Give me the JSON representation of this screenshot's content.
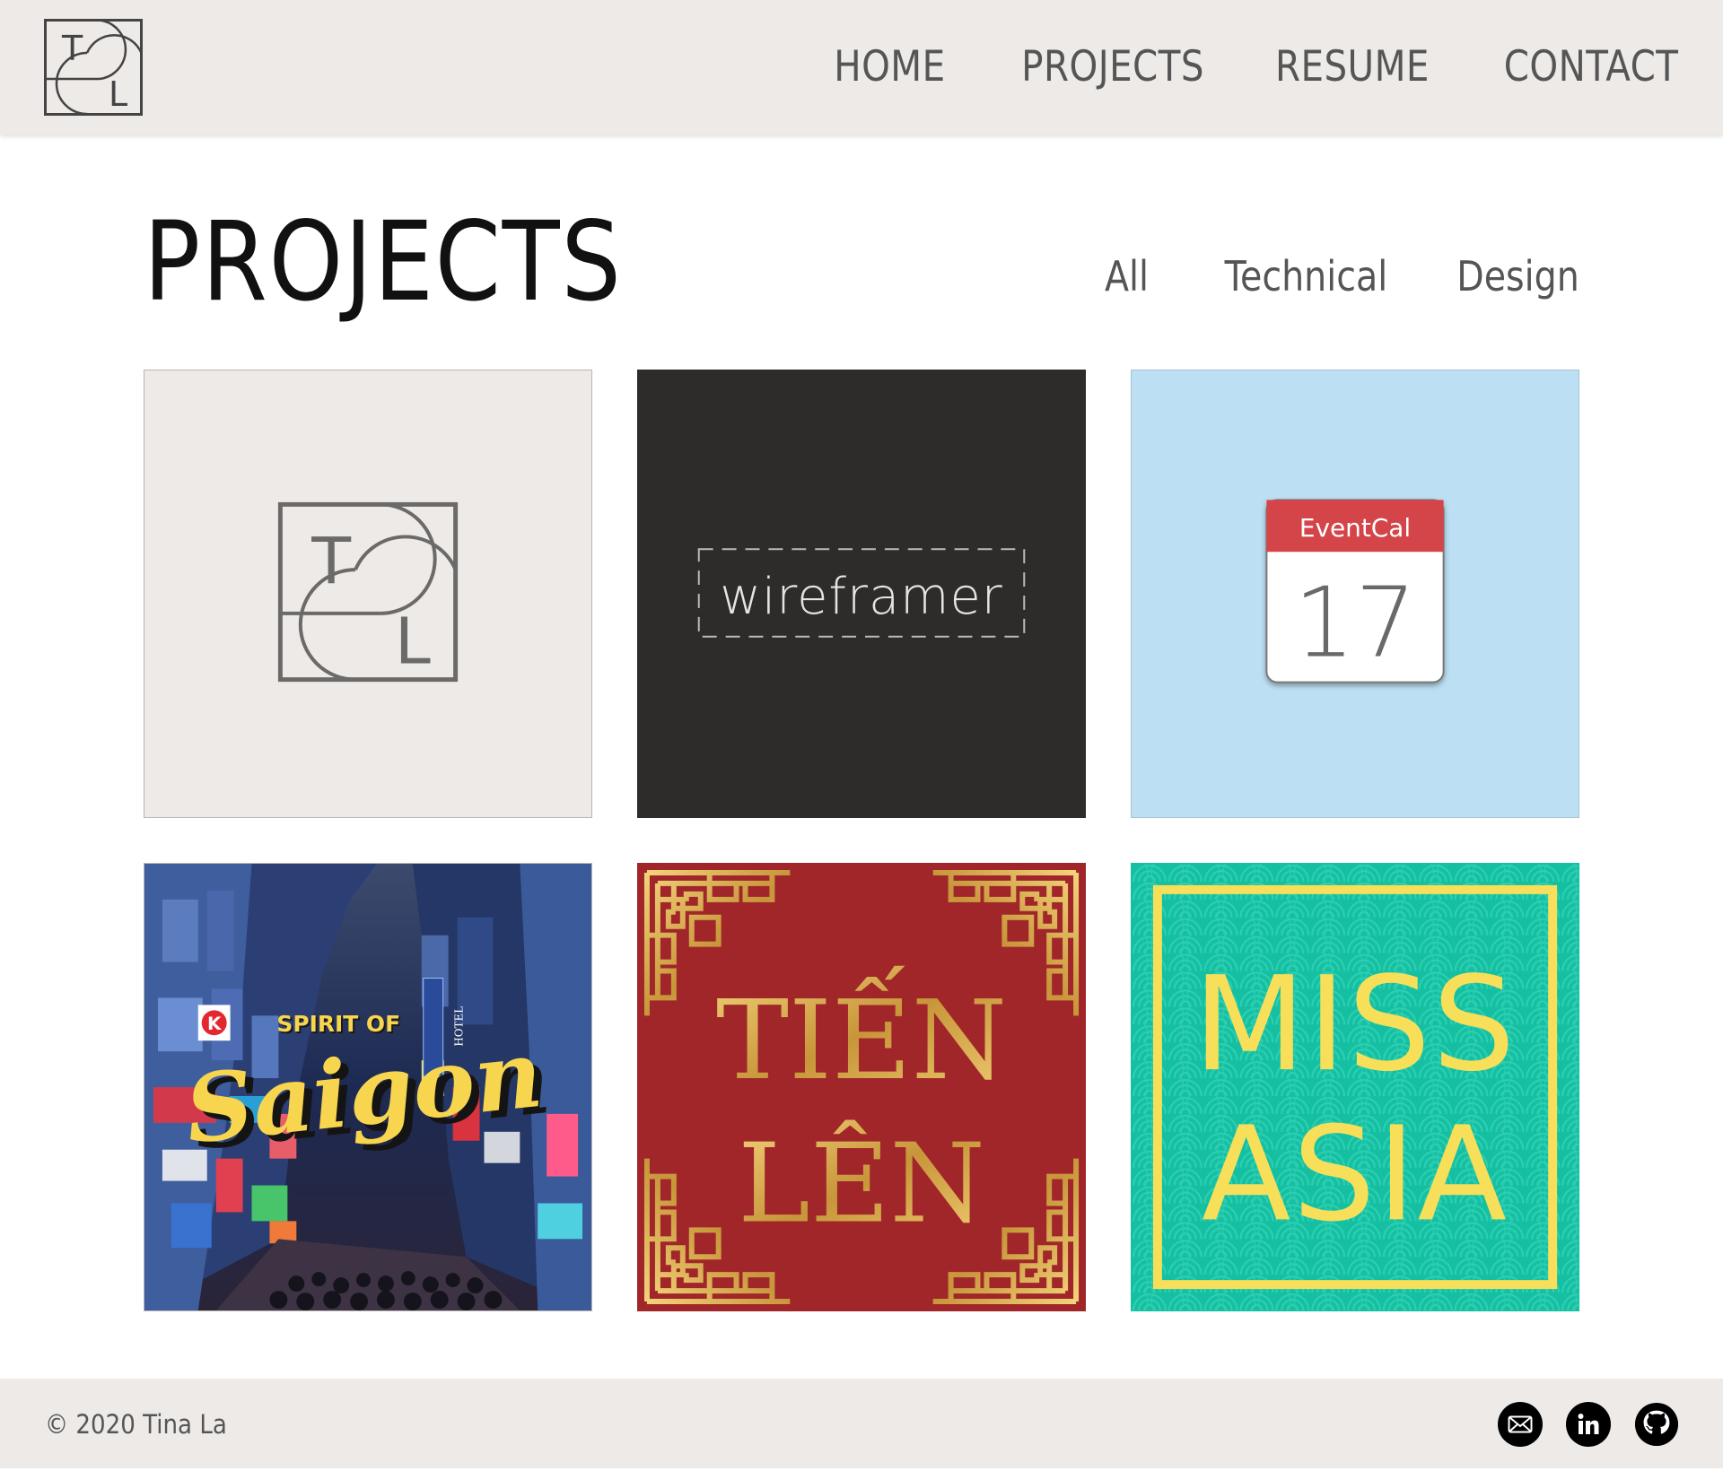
{
  "header": {
    "logo_letters": [
      "T",
      "L"
    ],
    "nav": [
      "HOME",
      "PROJECTS",
      "RESUME",
      "CONTACT"
    ]
  },
  "main": {
    "title": "PROJECTS",
    "filters": [
      "All",
      "Technical",
      "Design"
    ],
    "projects": [
      {
        "id": "logo",
        "letters": [
          "T",
          "L"
        ]
      },
      {
        "id": "wireframer",
        "text": "wireframer"
      },
      {
        "id": "eventcal",
        "app_name": "EventCal",
        "day": "17"
      },
      {
        "id": "saigon",
        "line1": "SPIRIT OF",
        "line2": "Saigon",
        "sign_k": "K",
        "sign_hotel": "HOTEL"
      },
      {
        "id": "tien-len",
        "line1": "TIẾN",
        "line2": "LÊN"
      },
      {
        "id": "miss-asia",
        "line1": "MISS",
        "line2": "ASIA"
      }
    ]
  },
  "footer": {
    "copyright": "© 2020 Tina La",
    "icons": [
      "mail-icon",
      "linkedin-icon",
      "github-icon"
    ]
  },
  "colors": {
    "header_bg": "#edeae8",
    "wireframer_bg": "#2e2b2b",
    "eventcal_bg": "#bddff3",
    "eventcal_red": "#d44549",
    "tien_len_bg": "#a0262a",
    "gold": "#d8a94a",
    "miss_asia_bg": "#15c0a2",
    "miss_asia_yellow": "#f8df5a"
  }
}
